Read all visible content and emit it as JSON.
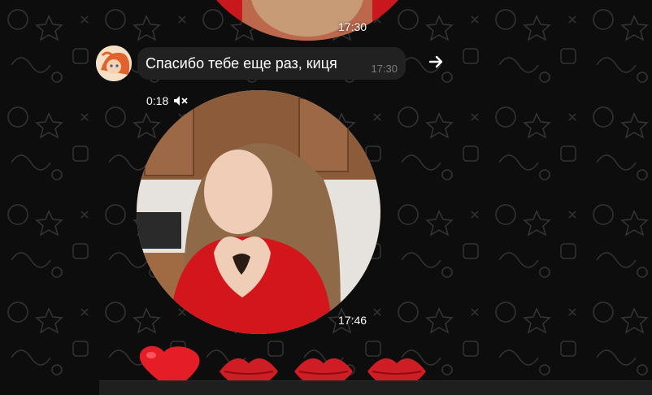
{
  "messages": [
    {
      "type": "video_note",
      "time": "17:30"
    },
    {
      "type": "text",
      "text": "Спасибо тебе еще раз, киця",
      "time": "17:30"
    },
    {
      "type": "video_note",
      "duration": "0:18",
      "time": "17:46"
    }
  ],
  "icons": {
    "forward": "forward-arrow-icon",
    "muted": "speaker-muted-icon",
    "reactions": [
      "red-heart-icon",
      "kiss-mark-icon",
      "kiss-mark-icon",
      "kiss-mark-icon"
    ]
  },
  "colors": {
    "background": "#0d0d0d",
    "bubble": "#212121",
    "accent_red": "#d3161c"
  }
}
